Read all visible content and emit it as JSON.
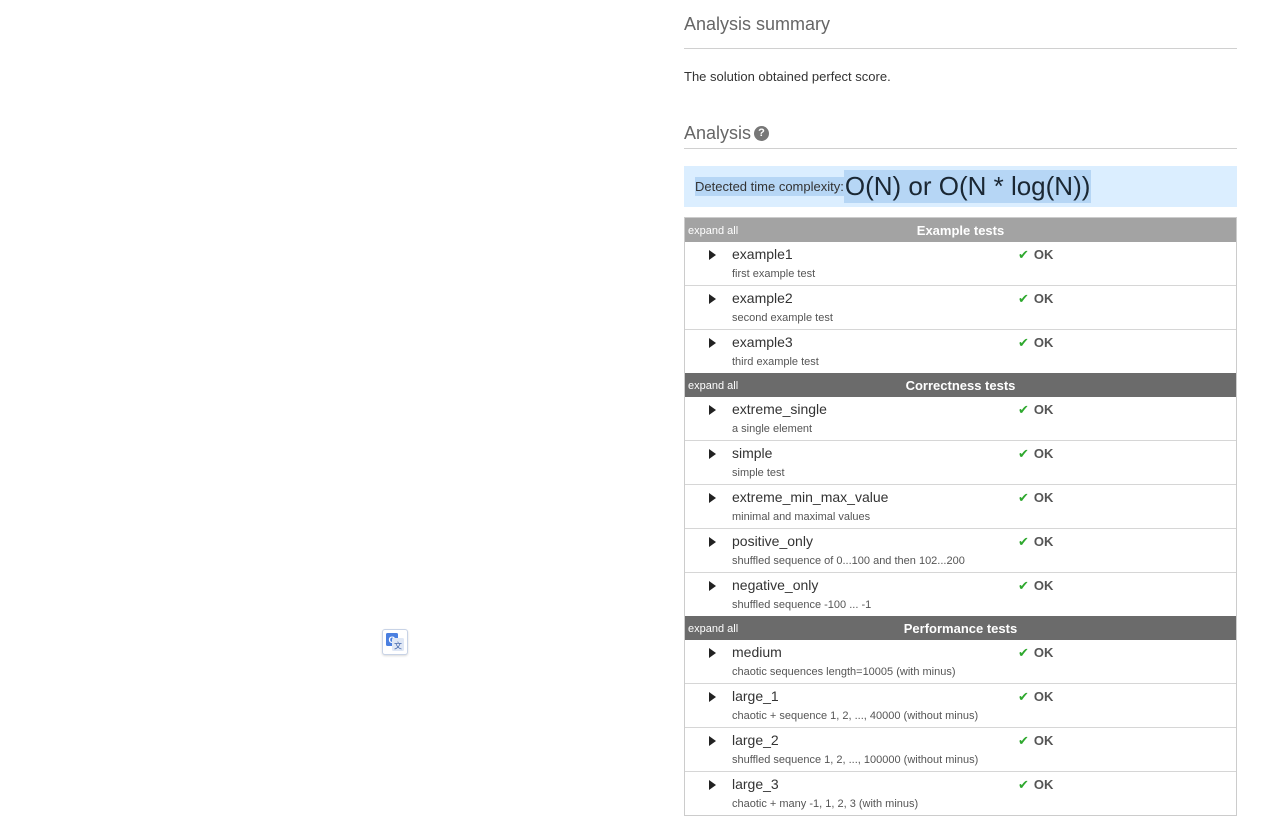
{
  "analysis_summary": {
    "heading": "Analysis summary",
    "text": "The solution obtained perfect score."
  },
  "analysis": {
    "heading": "Analysis",
    "help_icon": "question-mark-icon",
    "help_glyph": "?"
  },
  "complexity": {
    "label": "Detected time complexity:",
    "value": "O(N) or O(N * log(N))"
  },
  "translate_icon": "google-translate-icon",
  "colors": {
    "ok_check": "#2ea82e",
    "header_light": "#a3a3a3",
    "header_dark": "#6b6b6b",
    "complexity_bg": "#dbeeff"
  },
  "groups": [
    {
      "expand_label": "expand all",
      "title": "Example tests",
      "tests": [
        {
          "name": "example1",
          "desc": "first example test",
          "check": "✔",
          "result": "OK"
        },
        {
          "name": "example2",
          "desc": "second example test",
          "check": "✔",
          "result": "OK"
        },
        {
          "name": "example3",
          "desc": "third example test",
          "check": "✔",
          "result": "OK"
        }
      ]
    },
    {
      "expand_label": "expand all",
      "title": "Correctness tests",
      "tests": [
        {
          "name": "extreme_single",
          "desc": "a single element",
          "check": "✔",
          "result": "OK"
        },
        {
          "name": "simple",
          "desc": "simple test",
          "check": "✔",
          "result": "OK"
        },
        {
          "name": "extreme_min_max_value",
          "desc": "minimal and maximal values",
          "check": "✔",
          "result": "OK"
        },
        {
          "name": "positive_only",
          "desc": "shuffled sequence of 0...100 and then 102...200",
          "check": "✔",
          "result": "OK"
        },
        {
          "name": "negative_only",
          "desc": "shuffled sequence -100 ... -1",
          "check": "✔",
          "result": "OK"
        }
      ]
    },
    {
      "expand_label": "expand all",
      "title": "Performance tests",
      "tests": [
        {
          "name": "medium",
          "desc": "chaotic sequences length=10005 (with minus)",
          "check": "✔",
          "result": "OK"
        },
        {
          "name": "large_1",
          "desc": "chaotic + sequence 1, 2, ..., 40000 (without minus)",
          "check": "✔",
          "result": "OK"
        },
        {
          "name": "large_2",
          "desc": "shuffled sequence 1, 2, ..., 100000 (without minus)",
          "check": "✔",
          "result": "OK"
        },
        {
          "name": "large_3",
          "desc": "chaotic + many -1, 1, 2, 3 (with minus)",
          "check": "✔",
          "result": "OK"
        }
      ]
    }
  ]
}
